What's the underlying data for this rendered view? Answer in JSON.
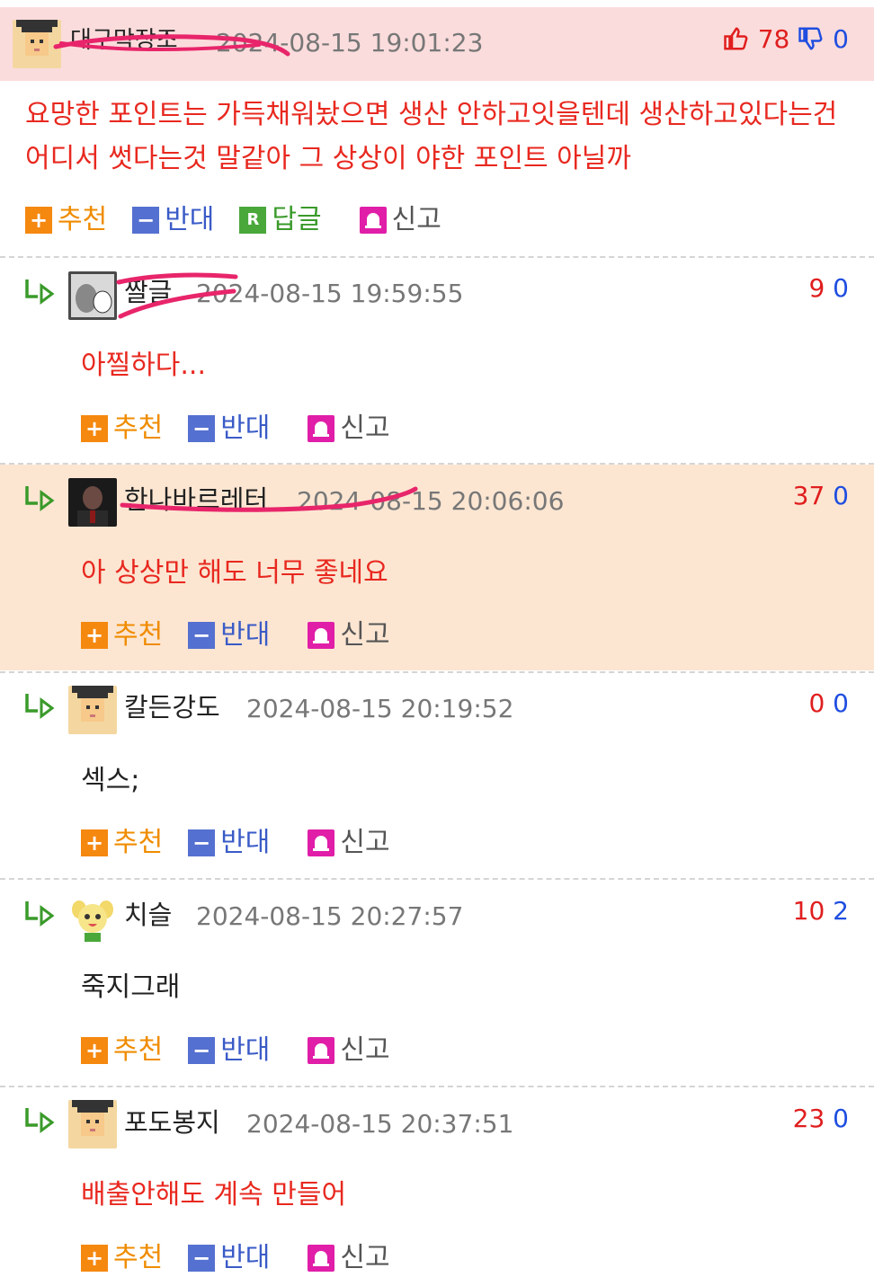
{
  "actions": {
    "recommend": "추천",
    "oppose": "반대",
    "reply": "답글",
    "report": "신고"
  },
  "colors": {
    "red_text": "#e8281f",
    "recommend": "#f5880f",
    "oppose": "#5470d0",
    "reply": "#4aa83a",
    "report": "#e01ea8",
    "scribble": "#e8256a"
  },
  "comments": [
    {
      "nick": "대구막장조",
      "time": "2024-08-15 19:01:23",
      "up": "78",
      "down": "0",
      "lines": [
        "요망한 포인트는 가득채워놨으면 생산 안하고잇을텐데 생산하고있다는건",
        "어디서 썻다는것 말같아 그 상상이 야한 포인트 아닐까"
      ]
    },
    {
      "nick": "짤글",
      "time": "2024-08-15 19:59:55",
      "up": "9",
      "down": "0",
      "lines": [
        "아찔하다..."
      ]
    },
    {
      "nick": "한나바르레터",
      "time": "2024-08-15 20:06:06",
      "up": "37",
      "down": "0",
      "lines": [
        "아 상상만 해도 너무 좋네요"
      ]
    },
    {
      "nick": "칼든강도",
      "time": "2024-08-15 20:19:52",
      "up": "0",
      "down": "0",
      "lines": [
        "섹스;"
      ]
    },
    {
      "nick": "치슬",
      "time": "2024-08-15 20:27:57",
      "up": "10",
      "down": "2",
      "lines": [
        "죽지그래"
      ]
    },
    {
      "nick": "포도봉지",
      "time": "2024-08-15 20:37:51",
      "up": "23",
      "down": "0",
      "lines": [
        "배출안해도 계속 만들어"
      ]
    }
  ]
}
